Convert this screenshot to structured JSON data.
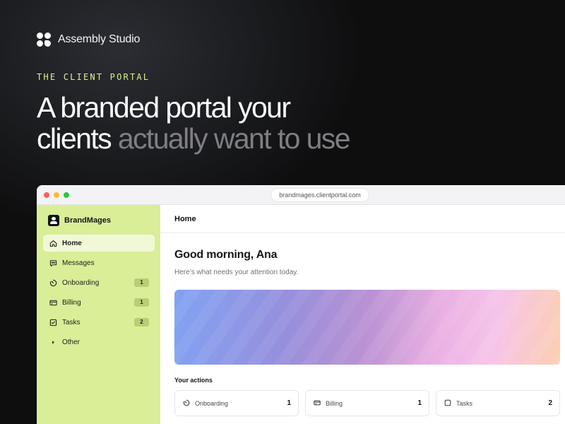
{
  "brand": {
    "name": "Assembly Studio",
    "logo_icon": "four-dots-logo-icon"
  },
  "eyebrow": "THE CLIENT PORTAL",
  "headline": {
    "line1": "A branded portal your",
    "line2_strong": "clients",
    "line2_muted": "actually want to use"
  },
  "browser": {
    "url": "brandmages.clientportal.com"
  },
  "sidebar": {
    "brand_name": "BrandMages",
    "items": [
      {
        "label": "Home",
        "icon": "home-icon",
        "active": true,
        "badge": ""
      },
      {
        "label": "Messages",
        "icon": "message-icon",
        "badge": ""
      },
      {
        "label": "Onboarding",
        "icon": "timer-icon",
        "badge": "1"
      },
      {
        "label": "Billing",
        "icon": "card-icon",
        "badge": "1"
      },
      {
        "label": "Tasks",
        "icon": "checkbox-icon",
        "badge": "2"
      },
      {
        "label": "Other",
        "icon": "caret-right-icon",
        "badge": ""
      }
    ]
  },
  "main": {
    "header_title": "Home",
    "greeting": "Good morning, Ana",
    "subtext": "Here’s what needs your attention today.",
    "actions_title": "Your actions",
    "actions": [
      {
        "label": "Onboarding",
        "count": "1",
        "icon": "timer-icon"
      },
      {
        "label": "Billing",
        "count": "1",
        "icon": "card-icon"
      },
      {
        "label": "Tasks",
        "count": "2",
        "icon": "checkbox-icon"
      }
    ]
  },
  "colors": {
    "accent_lime": "#d9ee97",
    "eyebrow_green": "#d8f28e",
    "background_dark": "#0d0d0e"
  }
}
